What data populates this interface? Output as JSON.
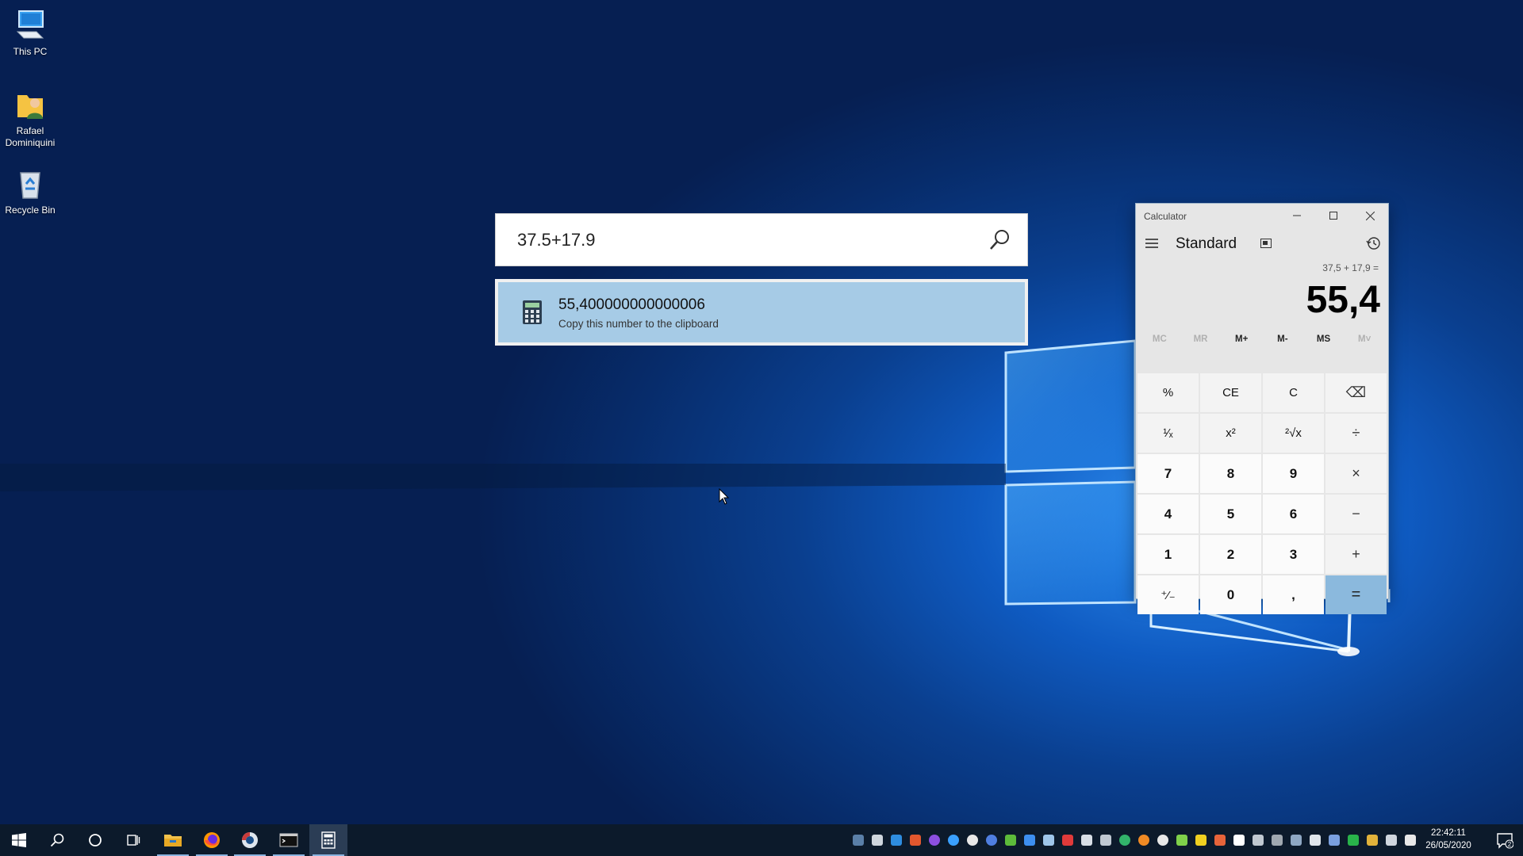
{
  "desktop": {
    "icons": [
      {
        "label": "This PC"
      },
      {
        "label": "Rafael Dominiquini"
      },
      {
        "label": "Recycle Bin"
      }
    ]
  },
  "search": {
    "query": "37.5+17.9",
    "result_value": "55,400000000000006",
    "result_hint": "Copy this number to the clipboard"
  },
  "calculator": {
    "window_title": "Calculator",
    "mode": "Standard",
    "expression": "37,5 + 17,9 =",
    "display": "55,4",
    "memory": [
      "MC",
      "MR",
      "M+",
      "M-",
      "MS",
      "M˅"
    ],
    "keys": [
      "%",
      "CE",
      "C",
      "⌫",
      "¹⁄ₓ",
      "x²",
      "²√x",
      "÷",
      "7",
      "8",
      "9",
      "×",
      "4",
      "5",
      "6",
      "−",
      "1",
      "2",
      "3",
      "+",
      "⁺⁄₋",
      "0",
      ",",
      "="
    ]
  },
  "taskbar": {
    "time": "22:42:11",
    "date": "26/05/2020",
    "notifications": "2"
  },
  "colors": {
    "accent": "#8bb9dd",
    "result_highlight": "#a6cbe6",
    "taskbar": "#0c1a2b"
  }
}
